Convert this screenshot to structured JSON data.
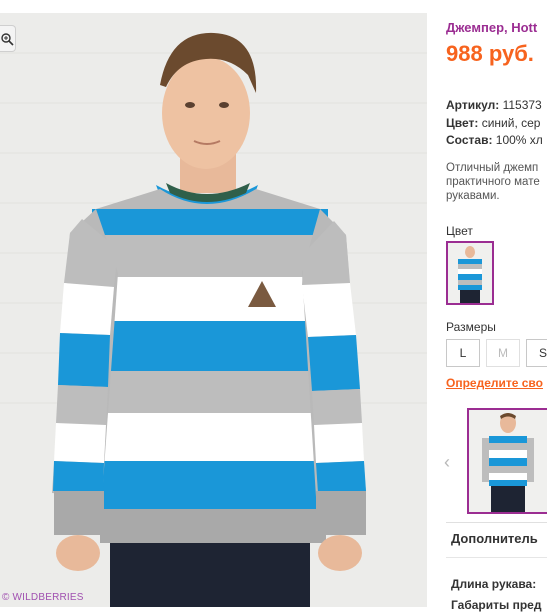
{
  "product": {
    "title": "Джемпер, Ноtt",
    "price": "988 руб.",
    "specs": [
      {
        "label": "Артикул:",
        "value": "115373"
      },
      {
        "label": "Цвет:",
        "value": "синий, сер"
      },
      {
        "label": "Состав:",
        "value": "100% хл"
      }
    ],
    "description_lines": [
      "Отличный джемп",
      "практичного мате",
      "рукавами."
    ]
  },
  "image": {
    "watermark": "© WILDBERRIES",
    "zoom_icon": "magnifier-icon"
  },
  "color_section": {
    "label": "Цвет"
  },
  "sizes_section": {
    "label": "Размеры",
    "sizes": [
      {
        "label": "L",
        "available": true
      },
      {
        "label": "M",
        "available": false
      },
      {
        "label": "S",
        "available": true
      }
    ],
    "size_link": "Определите сво"
  },
  "thumbnails": {
    "prev_icon": "chevron-left-icon"
  },
  "details": {
    "heading": "Дополнитель",
    "rows": [
      "Длина рукава:",
      "Габариты пред"
    ]
  },
  "colors": {
    "accent_purple": "#9b2d92",
    "price_orange": "#f7631e",
    "sweater_blue": "#1a97d8",
    "sweater_gray": "#b9b9b9"
  }
}
